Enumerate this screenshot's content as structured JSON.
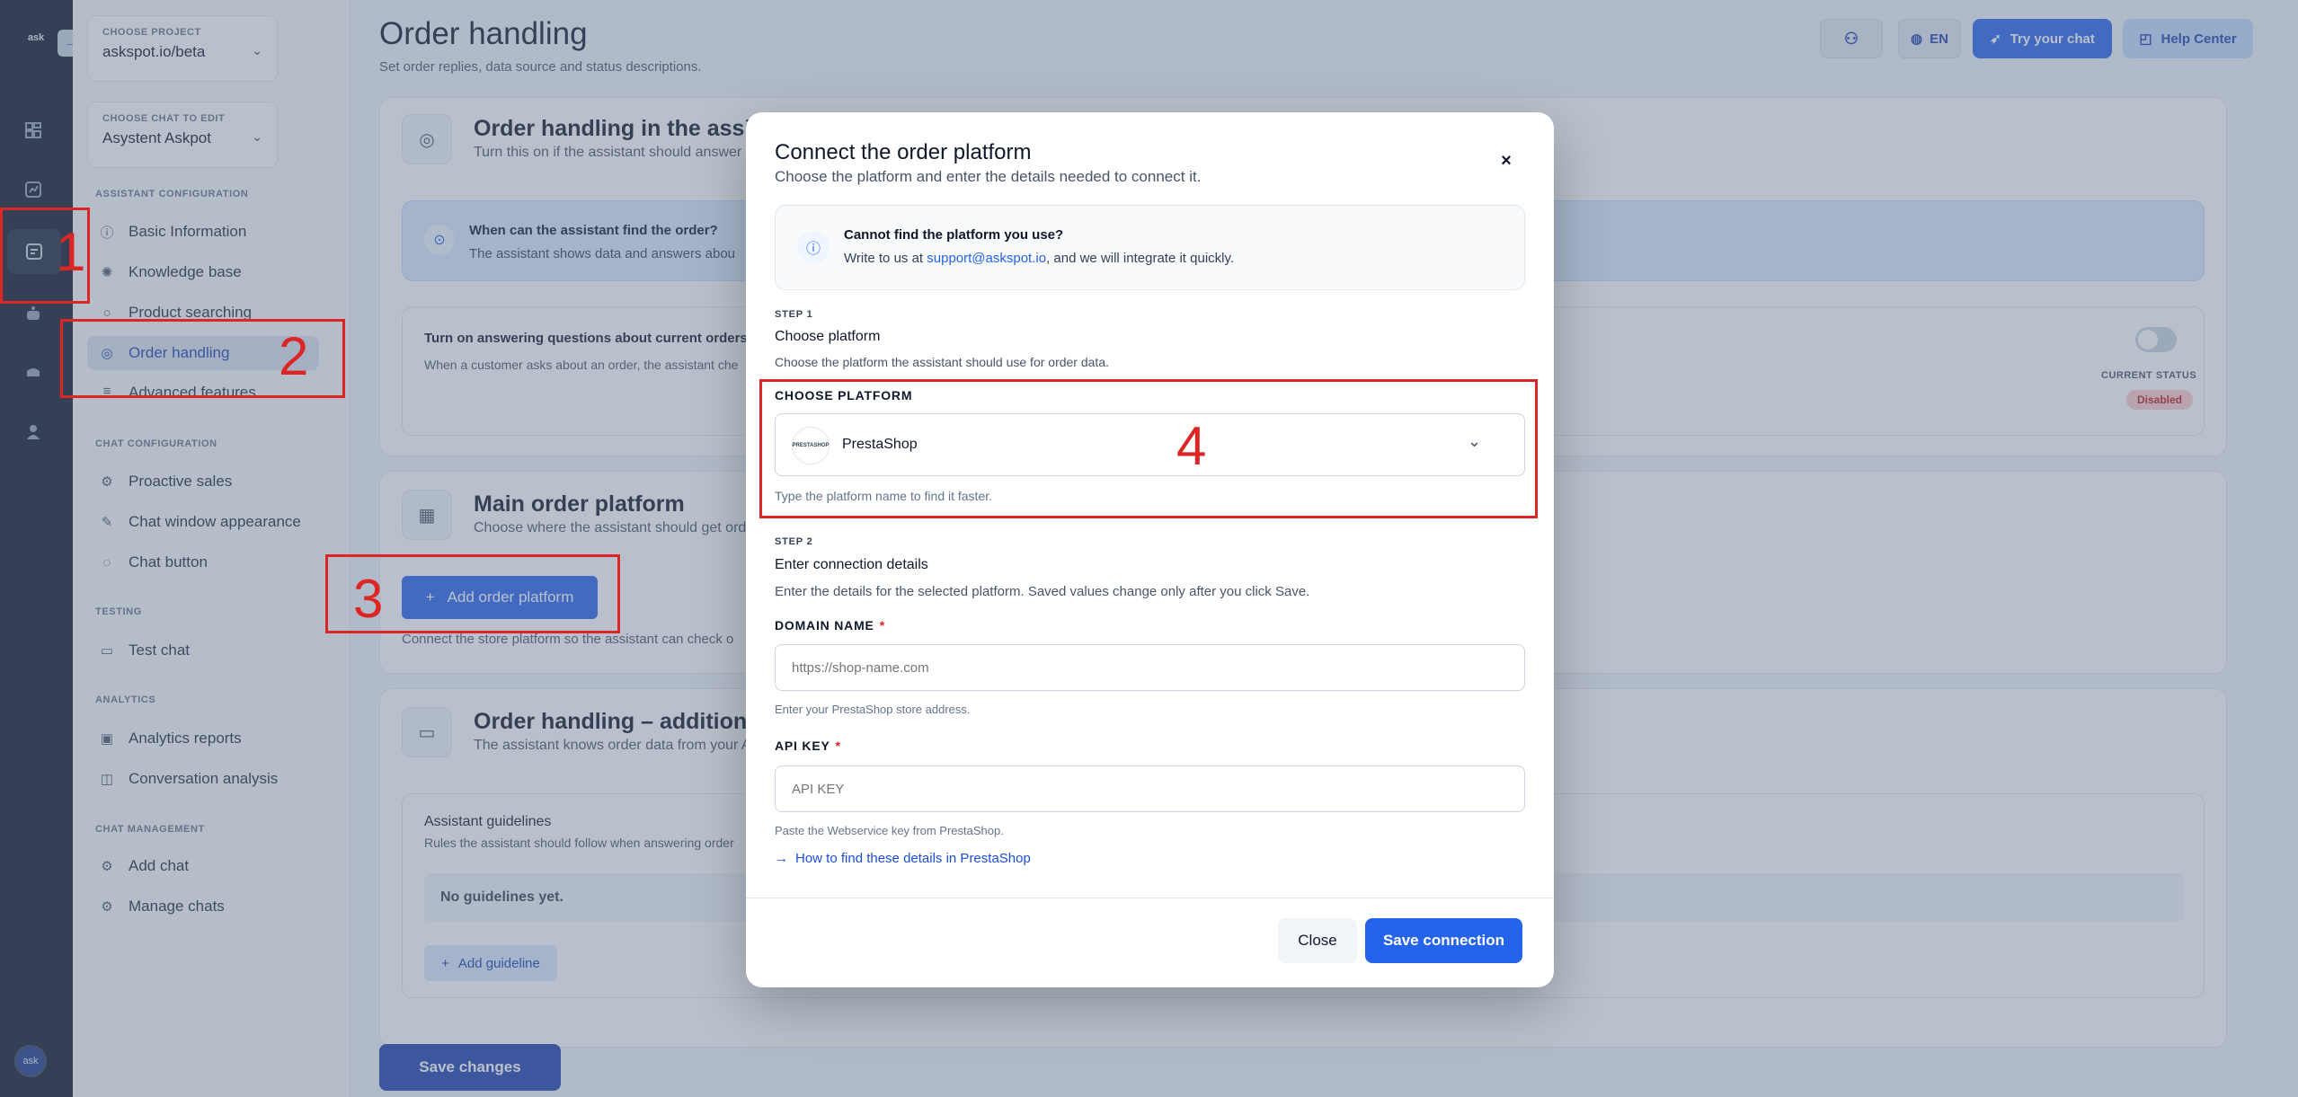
{
  "rail": {
    "logo": "ask",
    "expand_icon": "arrow-right-icon",
    "bottom_avatar": "ask"
  },
  "sidebar": {
    "project": {
      "caption": "CHOOSE PROJECT",
      "value": "askspot.io/beta"
    },
    "chat": {
      "caption": "CHOOSE CHAT TO EDIT",
      "value": "Asystent Askpot"
    },
    "sections": {
      "assistant": "ASSISTANT CONFIGURATION",
      "chat": "CHAT CONFIGURATION",
      "testing": "TESTING",
      "analytics": "ANALYTICS",
      "management": "CHAT MANAGEMENT"
    },
    "items": [
      {
        "label": "Basic Information",
        "icon": "info-icon"
      },
      {
        "label": "Knowledge base",
        "icon": "brain-icon"
      },
      {
        "label": "Product searching",
        "icon": "search-icon"
      },
      {
        "label": "Order handling",
        "icon": "order-icon"
      },
      {
        "label": "Advanced features",
        "icon": "sliders-icon"
      },
      {
        "label": "Proactive sales",
        "icon": "gear-icon"
      },
      {
        "label": "Chat window appearance",
        "icon": "brush-icon"
      },
      {
        "label": "Chat button",
        "icon": "chat-bubble-icon"
      },
      {
        "label": "Test chat",
        "icon": "message-icon"
      },
      {
        "label": "Analytics reports",
        "icon": "chart-icon"
      },
      {
        "label": "Conversation analysis",
        "icon": "conversation-icon"
      },
      {
        "label": "Add chat",
        "icon": "gear-icon"
      },
      {
        "label": "Manage chats",
        "icon": "gear-icon"
      }
    ]
  },
  "header": {
    "title": "Order handling",
    "subtitle": "Set order replies, data source and status descriptions.",
    "language": "EN",
    "try_chat": "Try your chat",
    "help_center": "Help Center"
  },
  "cards": {
    "assistant": {
      "title": "Order handling in the assistant",
      "subtitle": "Turn this on if the assistant should answer q",
      "info_title": "When can the assistant find the order?",
      "info_text": "The assistant shows data and answers abou",
      "toggle_title": "Turn on answering questions about current orders",
      "toggle_text": "When a customer asks about an order, the assistant che",
      "status_caption": "CURRENT STATUS",
      "status_value": "Disabled"
    },
    "platform": {
      "title": "Main order platform",
      "subtitle": "Choose where the assistant should get orde",
      "add_button": "Add order platform",
      "hint": "Connect the store platform so the assistant can check o"
    },
    "additional": {
      "title": "Order handling – additional in",
      "subtitle": "The assistant knows order data from your A",
      "guidelines_title": "Assistant guidelines",
      "guidelines_text": "Rules the assistant should follow when answering order",
      "empty": "No guidelines yet.",
      "add_guideline": "Add guideline"
    },
    "save_changes": "Save changes"
  },
  "modal": {
    "title": "Connect the order platform",
    "subtitle": "Choose the platform and enter the details needed to connect it.",
    "info": {
      "title": "Cannot find the platform you use?",
      "text_before": "Write to us at ",
      "email": "support@askspot.io",
      "text_after": ", and we will integrate it quickly."
    },
    "step1": {
      "tag": "STEP 1",
      "title": "Choose platform",
      "text": "Choose the platform the assistant should use for order data.",
      "label": "CHOOSE PLATFORM",
      "selected": "PrestaShop",
      "logo_text": "PRESTASHOP",
      "hint": "Type the platform name to find it faster."
    },
    "step2": {
      "tag": "STEP 2",
      "title": "Enter connection details",
      "text": "Enter the details for the selected platform. Saved values change only after you click Save.",
      "domain_label": "DOMAIN NAME",
      "domain_placeholder": "https://shop-name.com",
      "domain_hint": "Enter your PrestaShop store address.",
      "api_label": "API KEY",
      "api_placeholder": "API KEY",
      "api_hint": "Paste the Webservice key from PrestaShop.",
      "help_link": "How to find these details in PrestaShop"
    },
    "close": "Close",
    "save": "Save connection"
  },
  "annotations": [
    "1",
    "2",
    "3",
    "4"
  ],
  "colors": {
    "accent": "#2563eb",
    "annotation": "#dc2626",
    "rail": "#0f172a"
  }
}
